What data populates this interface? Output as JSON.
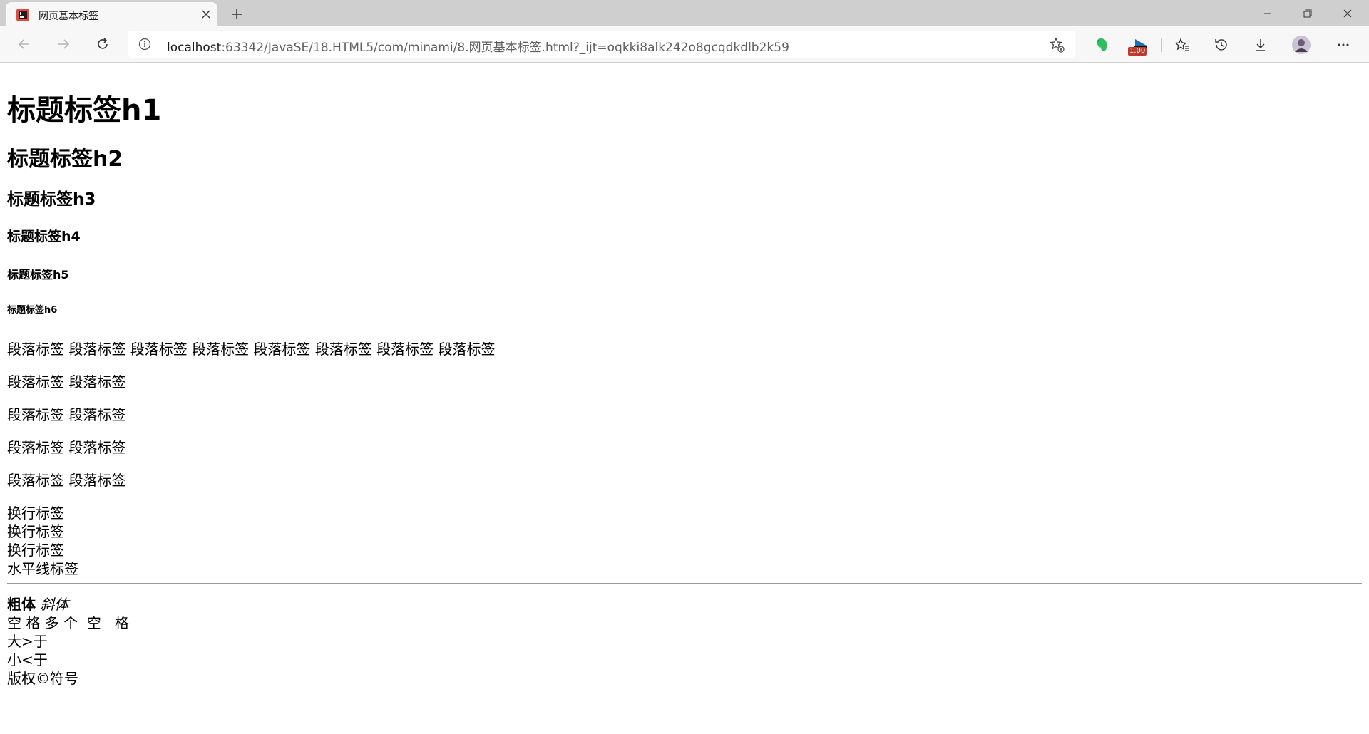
{
  "browser": {
    "tab_title": "网页基本标签",
    "url_host": "localhost",
    "url_rest": ":63342/JavaSE/18.HTML5/com/minami/8.网页基本标签.html?_ijt=oqkki8alk242o8gcqdkdlb2k59",
    "extension_badge": "1.00",
    "icons": [
      "back-icon",
      "forward-icon",
      "refresh-icon",
      "info-icon",
      "add-favorite-icon",
      "evernote-icon",
      "extension-icon",
      "favorites-icon",
      "history-icon",
      "download-icon",
      "profile-avatar",
      "more-icon"
    ]
  },
  "page": {
    "h1": "标题标签h1",
    "h2": "标题标签h2",
    "h3": "标题标签h3",
    "h4": "标题标签h4",
    "h5": "标题标签h5",
    "h6": "标题标签h6",
    "paragraphs": [
      "段落标签 段落标签 段落标签 段落标签 段落标签 段落标签 段落标签 段落标签",
      "段落标签 段落标签",
      "段落标签 段落标签",
      "段落标签 段落标签",
      "段落标签 段落标签"
    ],
    "line_breaks": [
      "换行标签",
      "换行标签",
      "换行标签",
      "水平线标签"
    ],
    "bold_text": "粗体",
    "italic_text": "斜体",
    "spaces_line": "空 格 多 个  空   格",
    "greater_line": "大>于",
    "less_line": "小<于",
    "copyright_line": "版权©符号"
  }
}
